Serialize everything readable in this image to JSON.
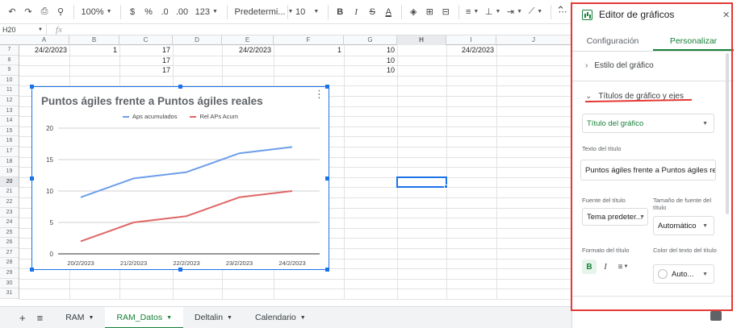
{
  "toolbar": {
    "zoom": "100%",
    "currency": "$",
    "percent": "%",
    "dec_decrease": ".0",
    "dec_increase": ".00",
    "number_format": "123",
    "font": "Predetermi...",
    "font_size": "10",
    "bold": "B",
    "italic": "I",
    "strike": "S",
    "text_color": "A",
    "more": "⋯"
  },
  "formula_bar": {
    "name_box": "H20",
    "fx": "fx"
  },
  "grid": {
    "columns": [
      "A",
      "B",
      "C",
      "D",
      "E",
      "F",
      "G",
      "H",
      "I",
      "J"
    ],
    "selected_column": "H",
    "rows": [
      "7",
      "8",
      "9",
      "10",
      "11",
      "12",
      "13",
      "14",
      "15",
      "16",
      "17",
      "18",
      "19",
      "20",
      "21",
      "22",
      "23",
      "24",
      "25",
      "26",
      "27",
      "28",
      "29",
      "30",
      "31"
    ],
    "selected_row": "20",
    "cells": {
      "a7": "24/2/2023",
      "b7": "1",
      "c7": "17",
      "c8": "17",
      "c9": "17",
      "e7": "24/2/2023",
      "f7": "1",
      "g7": "10",
      "g8": "10",
      "g9": "10",
      "i7": "24/2/2023"
    }
  },
  "chart": {
    "menu_icon": "⋮"
  },
  "chart_data": {
    "type": "line",
    "title": "Puntos ágiles frente a Puntos ágiles reales",
    "categories": [
      "20/2/2023",
      "21/2/2023",
      "22/2/2023",
      "23/2/2023",
      "24/2/2023"
    ],
    "series": [
      {
        "name": "Aps acumulados",
        "values": [
          9,
          12,
          13,
          16,
          17
        ],
        "color": "#6d9eeb"
      },
      {
        "name": "Rel APs Acum",
        "values": [
          2,
          5,
          6,
          9,
          10
        ],
        "color": "#e06666"
      }
    ],
    "yticks": [
      "0",
      "5",
      "10",
      "15",
      "20"
    ],
    "ylim": [
      0,
      20
    ],
    "grid": true,
    "legend": "top"
  },
  "sheet_tabs": {
    "add": "+",
    "all": "≡",
    "tabs": [
      {
        "label": "RAM",
        "active": false
      },
      {
        "label": "RAM_Datos",
        "active": true
      },
      {
        "label": "Deltalin",
        "active": false
      },
      {
        "label": "Calendario",
        "active": false
      }
    ]
  },
  "panel": {
    "title": "Editor de gráficos",
    "close": "×",
    "tab_setup": "Configuración",
    "tab_customize": "Personalizar",
    "section_style": "Estilo del gráfico",
    "section_titles": "Títulos de gráfico y ejes",
    "title_type": "Título del gráfico",
    "title_text_label": "Texto del título",
    "title_text_value": "Puntos ágiles frente a Puntos ágiles reales",
    "font_label": "Fuente del título",
    "font_value": "Tema predeter...",
    "size_label": "Tamaño de fuente del título",
    "size_value": "Automático",
    "format_label": "Formato del título",
    "color_label": "Color del texto del título",
    "color_value": "Auto...",
    "bold": "B",
    "italic": "I",
    "align": "≡",
    "accent": "#188038",
    "highlight": "#e53935"
  }
}
